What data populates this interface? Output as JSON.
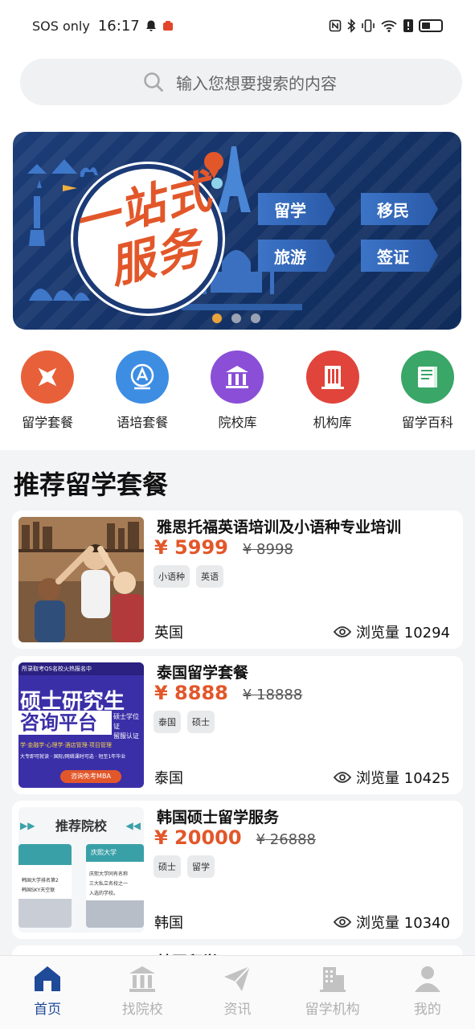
{
  "status_bar": {
    "carrier": "SOS only",
    "time": "16:17"
  },
  "search": {
    "placeholder": "输入您想要搜索的内容"
  },
  "banner": {
    "title": "一站式服务",
    "buttons": [
      "留学",
      "移民",
      "旅游",
      "签证"
    ],
    "slide_count": 3,
    "active_slide": 1
  },
  "quick_nav": [
    {
      "label": "留学套餐",
      "icon": "airplane-icon",
      "color": "#e8603a"
    },
    {
      "label": "语培套餐",
      "icon": "language-icon",
      "color": "#3d8de3"
    },
    {
      "label": "院校库",
      "icon": "school-icon",
      "color": "#8a4fd6"
    },
    {
      "label": "机构库",
      "icon": "building-icon",
      "color": "#e1443a"
    },
    {
      "label": "留学百科",
      "icon": "book-icon",
      "color": "#3aa668"
    }
  ],
  "section": {
    "title": "推荐留学套餐"
  },
  "packages": [
    {
      "title": "雅思托福英语培训及小语种专业培训",
      "price": "¥ 5999",
      "old_price": "¥ 8998",
      "tags": [
        "小语种",
        "英语"
      ],
      "country": "英国",
      "views": "浏览量 10294"
    },
    {
      "title": "泰国留学套餐",
      "price": "¥ 8888",
      "old_price": "¥ 18888",
      "tags": [
        "泰国",
        "硕士"
      ],
      "country": "泰国",
      "views": "浏览量 10425",
      "image_text": {
        "top": "所录取考QS名校火热报名中",
        "headline1": "硕士研究生",
        "headline2": "咨询平台",
        "side": "硕士学位证",
        "side2": "留服认证",
        "features": "学·金融学·心理学·酒店管理·项目管理",
        "features2": "大专即可就读 · 国际/网络课时可选 · 短至1年毕业",
        "cta": "咨询免考MBA"
      }
    },
    {
      "title": "韩国硕士留学服务",
      "price": "¥ 20000",
      "old_price": "¥ 26888",
      "tags": [
        "硕士",
        "留学"
      ],
      "country": "韩国",
      "views": "浏览量 10340",
      "image_text": {
        "header": "推荐院校",
        "left_line1": "韩国大学排名第2",
        "left_line2": "韩国SKY天空联",
        "right_title": "庆熙大学",
        "right_line1": "庆熙大学同有名称",
        "right_line2": "三大私立名校之一",
        "right_line3": "入选的学校。"
      }
    }
  ],
  "partial_card_title": "韩国留学",
  "tabbar": [
    {
      "label": "首页",
      "icon": "home-icon",
      "active": true
    },
    {
      "label": "找院校",
      "icon": "school-icon",
      "active": false
    },
    {
      "label": "资讯",
      "icon": "paper-plane-icon",
      "active": false
    },
    {
      "label": "留学机构",
      "icon": "building-icon",
      "active": false
    },
    {
      "label": "我的",
      "icon": "person-icon",
      "active": false
    }
  ]
}
